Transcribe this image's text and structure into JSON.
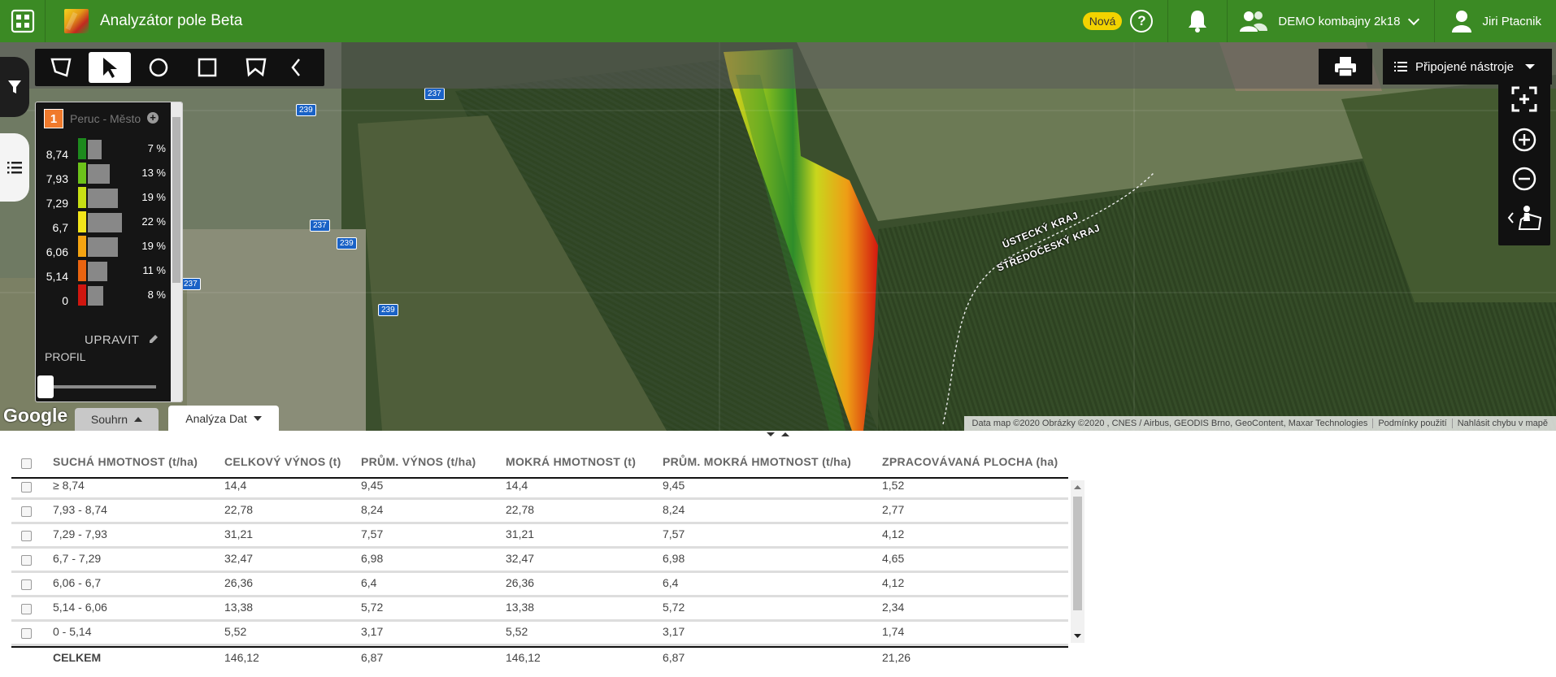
{
  "app": {
    "title": "Analyzátor pole Beta"
  },
  "topbar": {
    "new_badge": "Nová",
    "help": "?",
    "org_name": "DEMO kombajny 2k18",
    "user_name": "Jiri Ptacnik"
  },
  "map": {
    "tools_menu_label": "Připojené nástroje",
    "legend": {
      "field_number": "1",
      "field_name": "Peruc - Město",
      "rows": [
        {
          "value": "8,74",
          "percent": "7 %",
          "fraction": 0.07,
          "color": "#1d8a1d"
        },
        {
          "value": "7,93",
          "percent": "13 %",
          "fraction": 0.13,
          "color": "#6cc21a"
        },
        {
          "value": "7,29",
          "percent": "19 %",
          "fraction": 0.19,
          "color": "#c8e014"
        },
        {
          "value": "6,7",
          "percent": "22 %",
          "fraction": 0.22,
          "color": "#f3e51a"
        },
        {
          "value": "6,06",
          "percent": "19 %",
          "fraction": 0.19,
          "color": "#f5a411"
        },
        {
          "value": "5,14",
          "percent": "11 %",
          "fraction": 0.11,
          "color": "#ea6410"
        },
        {
          "value": "0",
          "percent": "8 %",
          "fraction": 0.08,
          "color": "#d0160f"
        }
      ],
      "edit_label": "UPRAVIT",
      "profile_label": "PROFIL"
    },
    "tabs": {
      "summary": "Souhrn",
      "analysis": "Analýza Dat"
    },
    "google": "Google",
    "attribution": {
      "data": "Data map ©2020 Obrázky ©2020 , CNES / Airbus, GEODIS Brno, GeoContent, Maxar Technologies",
      "terms": "Podmínky použití",
      "report": "Nahlásit chybu v mapě"
    },
    "roads": [
      "239",
      "237",
      "237",
      "239",
      "237",
      "239"
    ],
    "regions": {
      "north": "ÚSTECKÝ KRAJ",
      "south": "STŘEDOČESKÝ KRAJ"
    }
  },
  "table": {
    "headers": [
      "SUCHÁ HMOTNOST (t/ha)",
      "CELKOVÝ VÝNOS (t)",
      "PRŮM. VÝNOS (t/ha)",
      "MOKRÁ HMOTNOST (t)",
      "PRŮM. MOKRÁ HMOTNOST (t/ha)",
      "ZPRACOVÁVANÁ PLOCHA (ha)"
    ],
    "rows": [
      [
        "≥ 8,74",
        "14,4",
        "9,45",
        "14,4",
        "9,45",
        "1,52"
      ],
      [
        "7,93 - 8,74",
        "22,78",
        "8,24",
        "22,78",
        "8,24",
        "2,77"
      ],
      [
        "7,29 - 7,93",
        "31,21",
        "7,57",
        "31,21",
        "7,57",
        "4,12"
      ],
      [
        "6,7 - 7,29",
        "32,47",
        "6,98",
        "32,47",
        "6,98",
        "4,65"
      ],
      [
        "6,06 - 6,7",
        "26,36",
        "6,4",
        "26,36",
        "6,4",
        "4,12"
      ],
      [
        "5,14 - 6,06",
        "13,38",
        "5,72",
        "13,38",
        "5,72",
        "2,34"
      ],
      [
        "0 - 5,14",
        "5,52",
        "3,17",
        "5,52",
        "3,17",
        "1,74"
      ]
    ],
    "total": [
      "CELKEM",
      "146,12",
      "6,87",
      "146,12",
      "6,87",
      "21,26"
    ]
  }
}
